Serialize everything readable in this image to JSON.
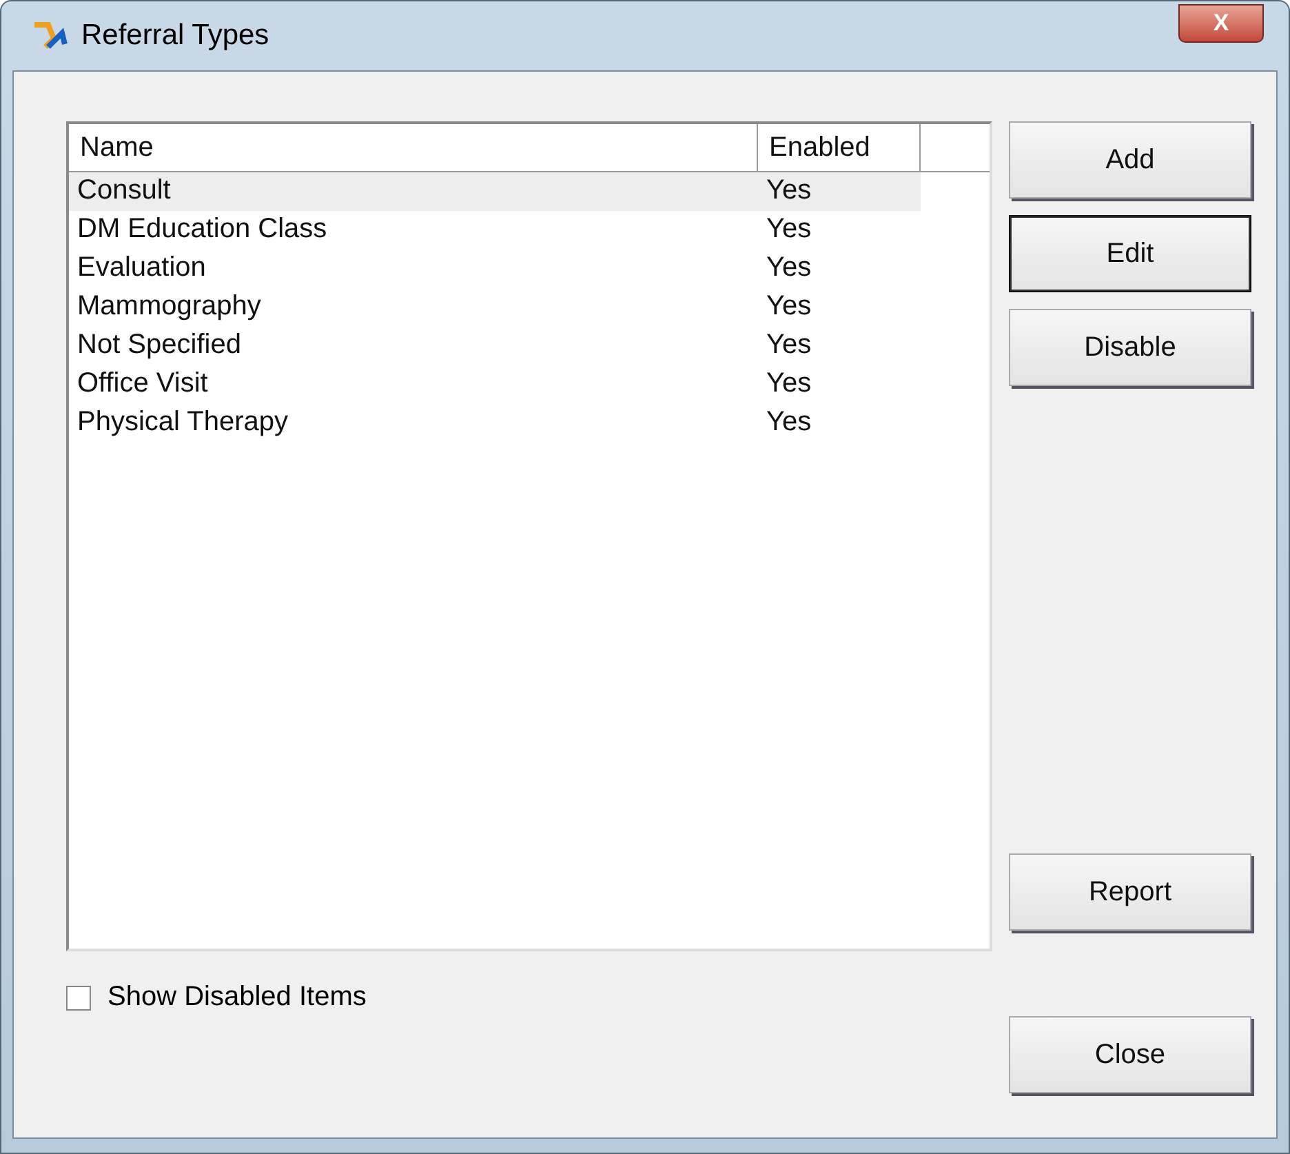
{
  "window": {
    "title": "Referral Types",
    "close_label": "X"
  },
  "table": {
    "columns": [
      "Name",
      "Enabled"
    ],
    "rows": [
      {
        "name": "Consult",
        "enabled": "Yes",
        "selected": true
      },
      {
        "name": "DM Education Class",
        "enabled": "Yes",
        "selected": false
      },
      {
        "name": "Evaluation",
        "enabled": "Yes",
        "selected": false
      },
      {
        "name": "Mammography",
        "enabled": "Yes",
        "selected": false
      },
      {
        "name": "Not Specified",
        "enabled": "Yes",
        "selected": false
      },
      {
        "name": "Office Visit",
        "enabled": "Yes",
        "selected": false
      },
      {
        "name": "Physical Therapy",
        "enabled": "Yes",
        "selected": false
      }
    ]
  },
  "buttons": [
    {
      "label": "Add",
      "default": false
    },
    {
      "label": "Edit",
      "default": true
    },
    {
      "label": "Disable",
      "default": false
    }
  ],
  "report_button": {
    "label": "Report"
  },
  "show_disabled": {
    "label": "Show Disabled Items",
    "checked": false
  },
  "close_button": {
    "label": "Close"
  }
}
